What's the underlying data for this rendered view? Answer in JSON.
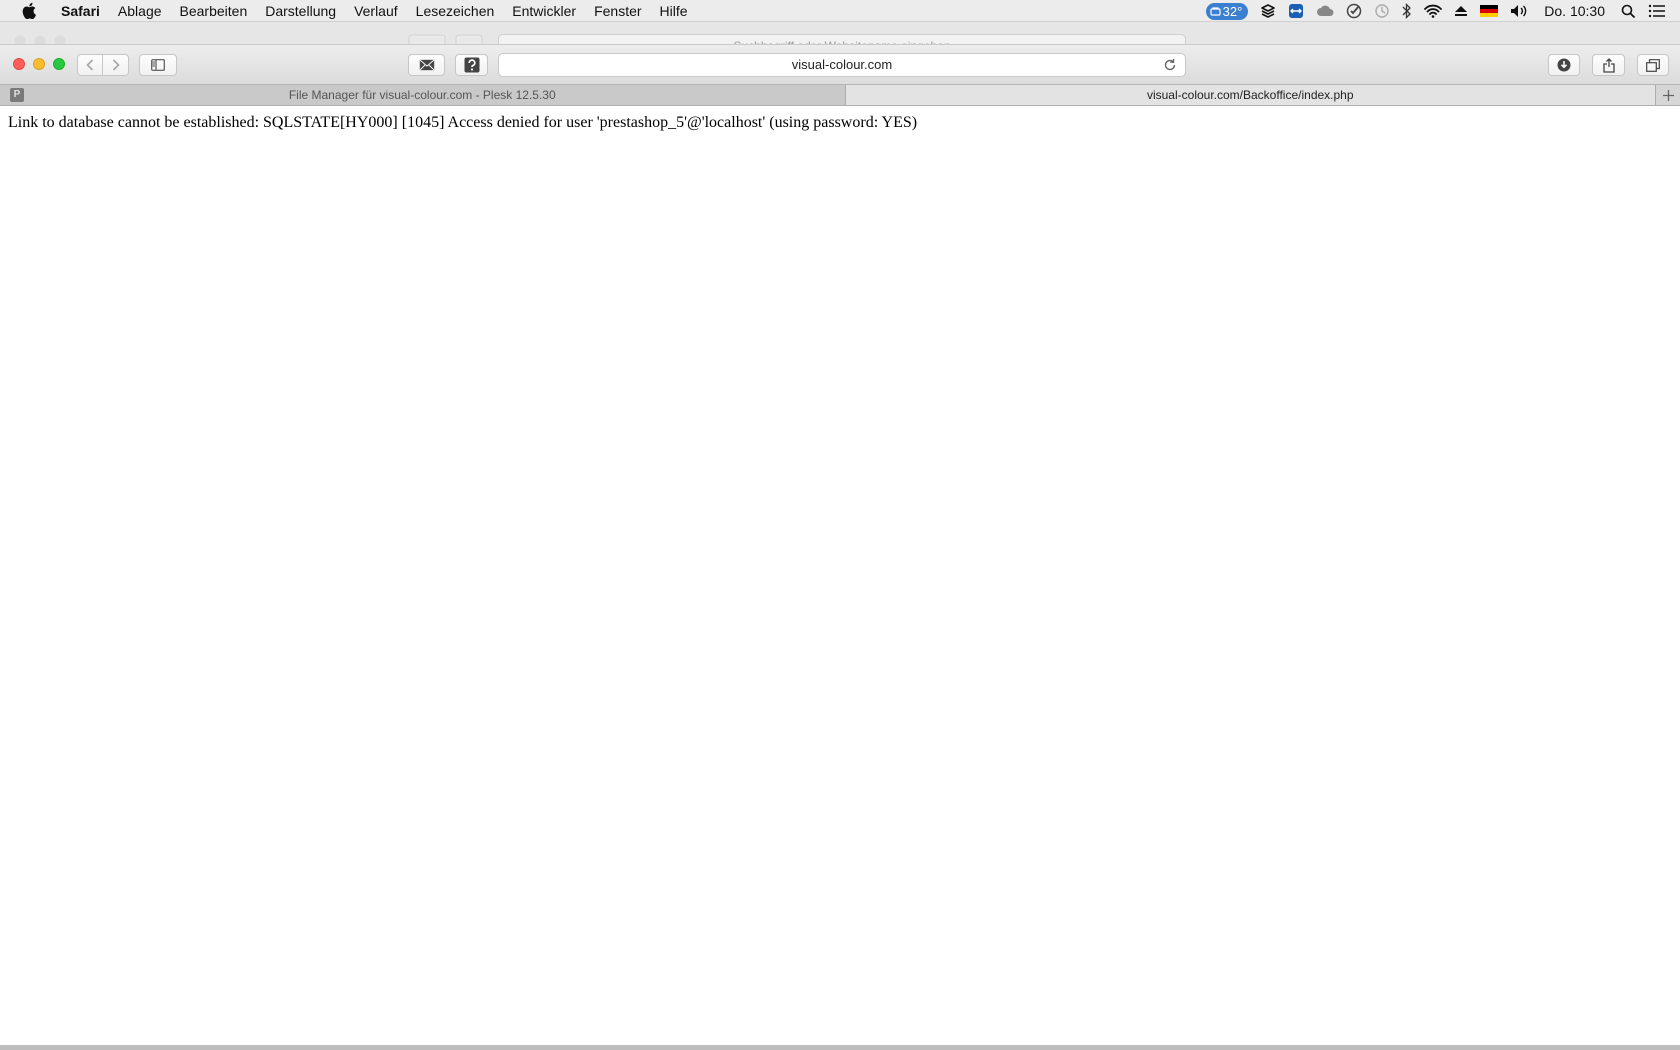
{
  "menubar": {
    "app_name": "Safari",
    "items": [
      "Ablage",
      "Bearbeiten",
      "Darstellung",
      "Verlauf",
      "Lesezeichen",
      "Entwickler",
      "Fenster",
      "Hilfe"
    ],
    "status": {
      "temperature": "32°",
      "clock": "Do. 10:30",
      "icons": [
        "temperature-icon",
        "dropbox-icon",
        "teamviewer-icon",
        "creative-cloud-icon",
        "checkmark-icon",
        "time-machine-icon",
        "bluetooth-icon",
        "wifi-icon",
        "eject-icon",
        "german-flag-icon",
        "volume-icon",
        "spotlight-search-icon",
        "notification-center-icon"
      ]
    }
  },
  "background_window": {
    "search_placeholder": "Suchbegriff oder Websitename eingeben"
  },
  "toolbar": {
    "url": "visual-colour.com",
    "icons": [
      "close-icon",
      "minimize-icon",
      "maximize-icon",
      "back-icon",
      "forward-icon",
      "sidebar-icon",
      "mail-icon",
      "help-icon",
      "reload-icon",
      "downloads-icon",
      "share-icon",
      "tabs-overview-icon"
    ]
  },
  "tabs": [
    {
      "title": "File Manager für visual-colour.com - Plesk 12.5.30",
      "favicon": "P",
      "active": false
    },
    {
      "title": "visual-colour.com/Backoffice/index.php",
      "active": true
    }
  ],
  "page": {
    "error_message": "Link to database cannot be established: SQLSTATE[HY000] [1045] Access denied for user 'prestashop_5'@'localhost' (using password: YES)"
  },
  "colors": {
    "menubar_bg": "#ececec",
    "temperature_badge": "#3b7fd0",
    "traffic_close": "#fc5f57",
    "traffic_minimize": "#fdbc2e",
    "traffic_maximize": "#28c840"
  }
}
